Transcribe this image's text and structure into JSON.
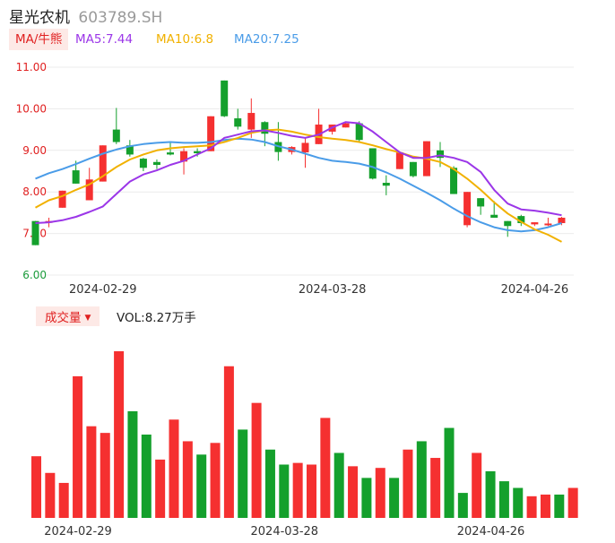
{
  "header": {
    "name": "星光农机",
    "code": "603789.SH"
  },
  "legend": {
    "ma_selector": "MA/牛熊",
    "ma5": "MA5:7.44",
    "ma10": "MA10:6.8",
    "ma20": "MA20:7.25"
  },
  "volume_panel": {
    "selector_label": "成交量",
    "selector_icon": "caret-down-icon",
    "vol_text": "VOL:8.27万手"
  },
  "colors": {
    "up": "#f53030",
    "down": "#14a02c",
    "ma5": "#9b36e8",
    "ma10": "#f1b100",
    "ma20": "#4a9ce8",
    "accent": "#e02020"
  },
  "chart_data": [
    {
      "type": "candlestick",
      "y_ticks": [
        "11.00",
        "10.00",
        "9.00",
        "8.00",
        "7.00",
        "6.00"
      ],
      "ylim": [
        6.0,
        11.0
      ],
      "x_labels": [
        {
          "index": 5,
          "label": "2024-02-29"
        },
        {
          "index": 22,
          "label": "2024-03-28"
        },
        {
          "index": 37,
          "label": "2024-04-26"
        }
      ],
      "grid": true,
      "candles": [
        {
          "o": 7.3,
          "c": 6.72,
          "h": 7.3,
          "l": 6.72
        },
        {
          "o": 7.3,
          "c": 7.3,
          "h": 7.38,
          "l": 7.15
        },
        {
          "o": 7.62,
          "c": 8.03,
          "h": 8.03,
          "l": 7.62
        },
        {
          "o": 8.52,
          "c": 8.2,
          "h": 8.75,
          "l": 8.2
        },
        {
          "o": 7.8,
          "c": 8.3,
          "h": 8.58,
          "l": 7.8
        },
        {
          "o": 8.25,
          "c": 9.12,
          "h": 9.12,
          "l": 8.25
        },
        {
          "o": 9.5,
          "c": 9.2,
          "h": 10.02,
          "l": 9.15
        },
        {
          "o": 9.12,
          "c": 8.9,
          "h": 9.25,
          "l": 8.85
        },
        {
          "o": 8.8,
          "c": 8.58,
          "h": 8.82,
          "l": 8.5
        },
        {
          "o": 8.72,
          "c": 8.65,
          "h": 8.78,
          "l": 8.55
        },
        {
          "o": 8.95,
          "c": 8.9,
          "h": 9.2,
          "l": 8.88
        },
        {
          "o": 8.73,
          "c": 8.98,
          "h": 9.05,
          "l": 8.42
        },
        {
          "o": 8.98,
          "c": 8.93,
          "h": 9.05,
          "l": 8.85
        },
        {
          "o": 8.98,
          "c": 9.82,
          "h": 9.82,
          "l": 8.98
        },
        {
          "o": 10.68,
          "c": 9.82,
          "h": 10.68,
          "l": 9.8
        },
        {
          "o": 9.77,
          "c": 9.57,
          "h": 10.0,
          "l": 9.5
        },
        {
          "o": 9.5,
          "c": 9.9,
          "h": 10.25,
          "l": 9.3
        },
        {
          "o": 9.68,
          "c": 9.4,
          "h": 9.7,
          "l": 9.1
        },
        {
          "o": 9.2,
          "c": 8.96,
          "h": 9.68,
          "l": 8.75
        },
        {
          "o": 8.96,
          "c": 9.08,
          "h": 9.1,
          "l": 8.9
        },
        {
          "o": 8.95,
          "c": 9.18,
          "h": 9.3,
          "l": 8.58
        },
        {
          "o": 9.15,
          "c": 9.62,
          "h": 10.0,
          "l": 9.15
        },
        {
          "o": 9.45,
          "c": 9.62,
          "h": 9.62,
          "l": 9.38
        },
        {
          "o": 9.55,
          "c": 9.65,
          "h": 9.68,
          "l": 9.55
        },
        {
          "o": 9.65,
          "c": 9.25,
          "h": 9.7,
          "l": 9.2
        },
        {
          "o": 9.05,
          "c": 8.32,
          "h": 9.05,
          "l": 8.3
        },
        {
          "o": 8.22,
          "c": 8.15,
          "h": 8.4,
          "l": 7.92
        },
        {
          "o": 8.55,
          "c": 8.95,
          "h": 8.95,
          "l": 8.55
        },
        {
          "o": 8.72,
          "c": 8.38,
          "h": 8.72,
          "l": 8.35
        },
        {
          "o": 8.38,
          "c": 9.22,
          "h": 9.22,
          "l": 8.38
        },
        {
          "o": 9.0,
          "c": 8.82,
          "h": 9.2,
          "l": 8.6
        },
        {
          "o": 8.58,
          "c": 7.95,
          "h": 8.62,
          "l": 7.95
        },
        {
          "o": 7.2,
          "c": 8.0,
          "h": 8.0,
          "l": 7.15
        },
        {
          "o": 7.85,
          "c": 7.65,
          "h": 7.85,
          "l": 7.45
        },
        {
          "o": 7.45,
          "c": 7.38,
          "h": 7.78,
          "l": 7.38
        },
        {
          "o": 7.3,
          "c": 7.18,
          "h": 7.3,
          "l": 6.92
        },
        {
          "o": 7.42,
          "c": 7.25,
          "h": 7.45,
          "l": 7.18
        },
        {
          "o": 7.22,
          "c": 7.27,
          "h": 7.27,
          "l": 7.18
        },
        {
          "o": 7.22,
          "c": 7.24,
          "h": 7.38,
          "l": 7.18
        },
        {
          "o": 7.25,
          "c": 7.38,
          "h": 7.4,
          "l": 7.2
        }
      ],
      "ma5": [
        7.25,
        7.27,
        7.32,
        7.4,
        7.52,
        7.65,
        7.95,
        8.25,
        8.42,
        8.52,
        8.65,
        8.75,
        8.9,
        9.05,
        9.3,
        9.38,
        9.46,
        9.48,
        9.42,
        9.35,
        9.3,
        9.38,
        9.55,
        9.68,
        9.65,
        9.45,
        9.2,
        8.95,
        8.82,
        8.82,
        8.88,
        8.82,
        8.72,
        8.48,
        8.05,
        7.72,
        7.58,
        7.55,
        7.5,
        7.44
      ],
      "ma10": [
        7.62,
        7.8,
        7.9,
        8.05,
        8.18,
        8.38,
        8.6,
        8.78,
        8.9,
        9.0,
        9.05,
        9.08,
        9.1,
        9.12,
        9.2,
        9.3,
        9.42,
        9.48,
        9.5,
        9.45,
        9.38,
        9.32,
        9.28,
        9.25,
        9.2,
        9.12,
        9.03,
        8.95,
        8.85,
        8.8,
        8.72,
        8.55,
        8.32,
        8.05,
        7.75,
        7.48,
        7.28,
        7.1,
        6.97,
        6.8
      ],
      "ma20": [
        8.32,
        8.45,
        8.55,
        8.67,
        8.8,
        8.92,
        9.02,
        9.1,
        9.15,
        9.18,
        9.2,
        9.18,
        9.18,
        9.2,
        9.25,
        9.28,
        9.26,
        9.2,
        9.1,
        9.02,
        8.92,
        8.82,
        8.75,
        8.72,
        8.68,
        8.6,
        8.47,
        8.32,
        8.15,
        7.98,
        7.8,
        7.6,
        7.42,
        7.27,
        7.15,
        7.08,
        7.05,
        7.08,
        7.15,
        7.25
      ]
    },
    {
      "type": "bar",
      "x_labels": [
        {
          "index": 0,
          "label": "2024-02-29"
        },
        {
          "index": 18,
          "label": "2024-03-28"
        },
        {
          "index": 33,
          "label": "2024-04-26"
        }
      ],
      "volume_relative": [
        0.37,
        0.27,
        0.21,
        0.85,
        0.55,
        0.51,
        1.0,
        0.64,
        0.5,
        0.35,
        0.59,
        0.46,
        0.38,
        0.45,
        0.91,
        0.53,
        0.69,
        0.41,
        0.32,
        0.33,
        0.32,
        0.6,
        0.39,
        0.31,
        0.24,
        0.3,
        0.24,
        0.41,
        0.46,
        0.36,
        0.54,
        0.15,
        0.39,
        0.28,
        0.22,
        0.18,
        0.13,
        0.14,
        0.14,
        0.18
      ],
      "volume_up": [
        true,
        true,
        true,
        true,
        true,
        true,
        true,
        false,
        false,
        true,
        true,
        true,
        false,
        true,
        true,
        false,
        true,
        false,
        false,
        true,
        true,
        true,
        false,
        true,
        false,
        true,
        false,
        true,
        false,
        true,
        false,
        false,
        true,
        false,
        false,
        false,
        true,
        true,
        false,
        true
      ]
    }
  ]
}
